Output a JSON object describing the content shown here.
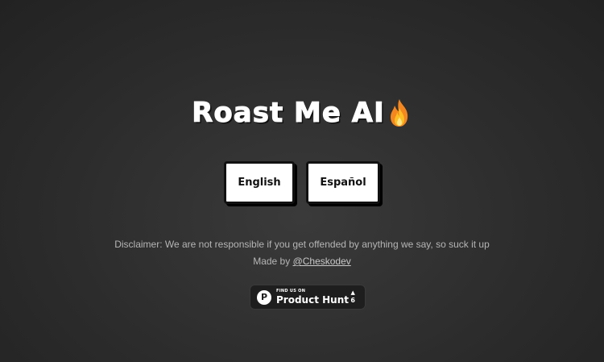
{
  "header": {
    "title": "Roast Me AI"
  },
  "languages": {
    "english_label": "English",
    "spanish_label": "Español"
  },
  "footer": {
    "disclaimer": "Disclaimer: We are not responsible if you get offended by anything we say, so suck it up",
    "made_by_prefix": "Made by ",
    "made_by_link": "@Cheskodev"
  },
  "product_hunt": {
    "small_label": "FIND US ON",
    "big_label": "Product Hunt",
    "logo_letter": "P",
    "arrow": "▲",
    "votes": "6"
  },
  "icons": {
    "title_icon": "fire-icon"
  }
}
